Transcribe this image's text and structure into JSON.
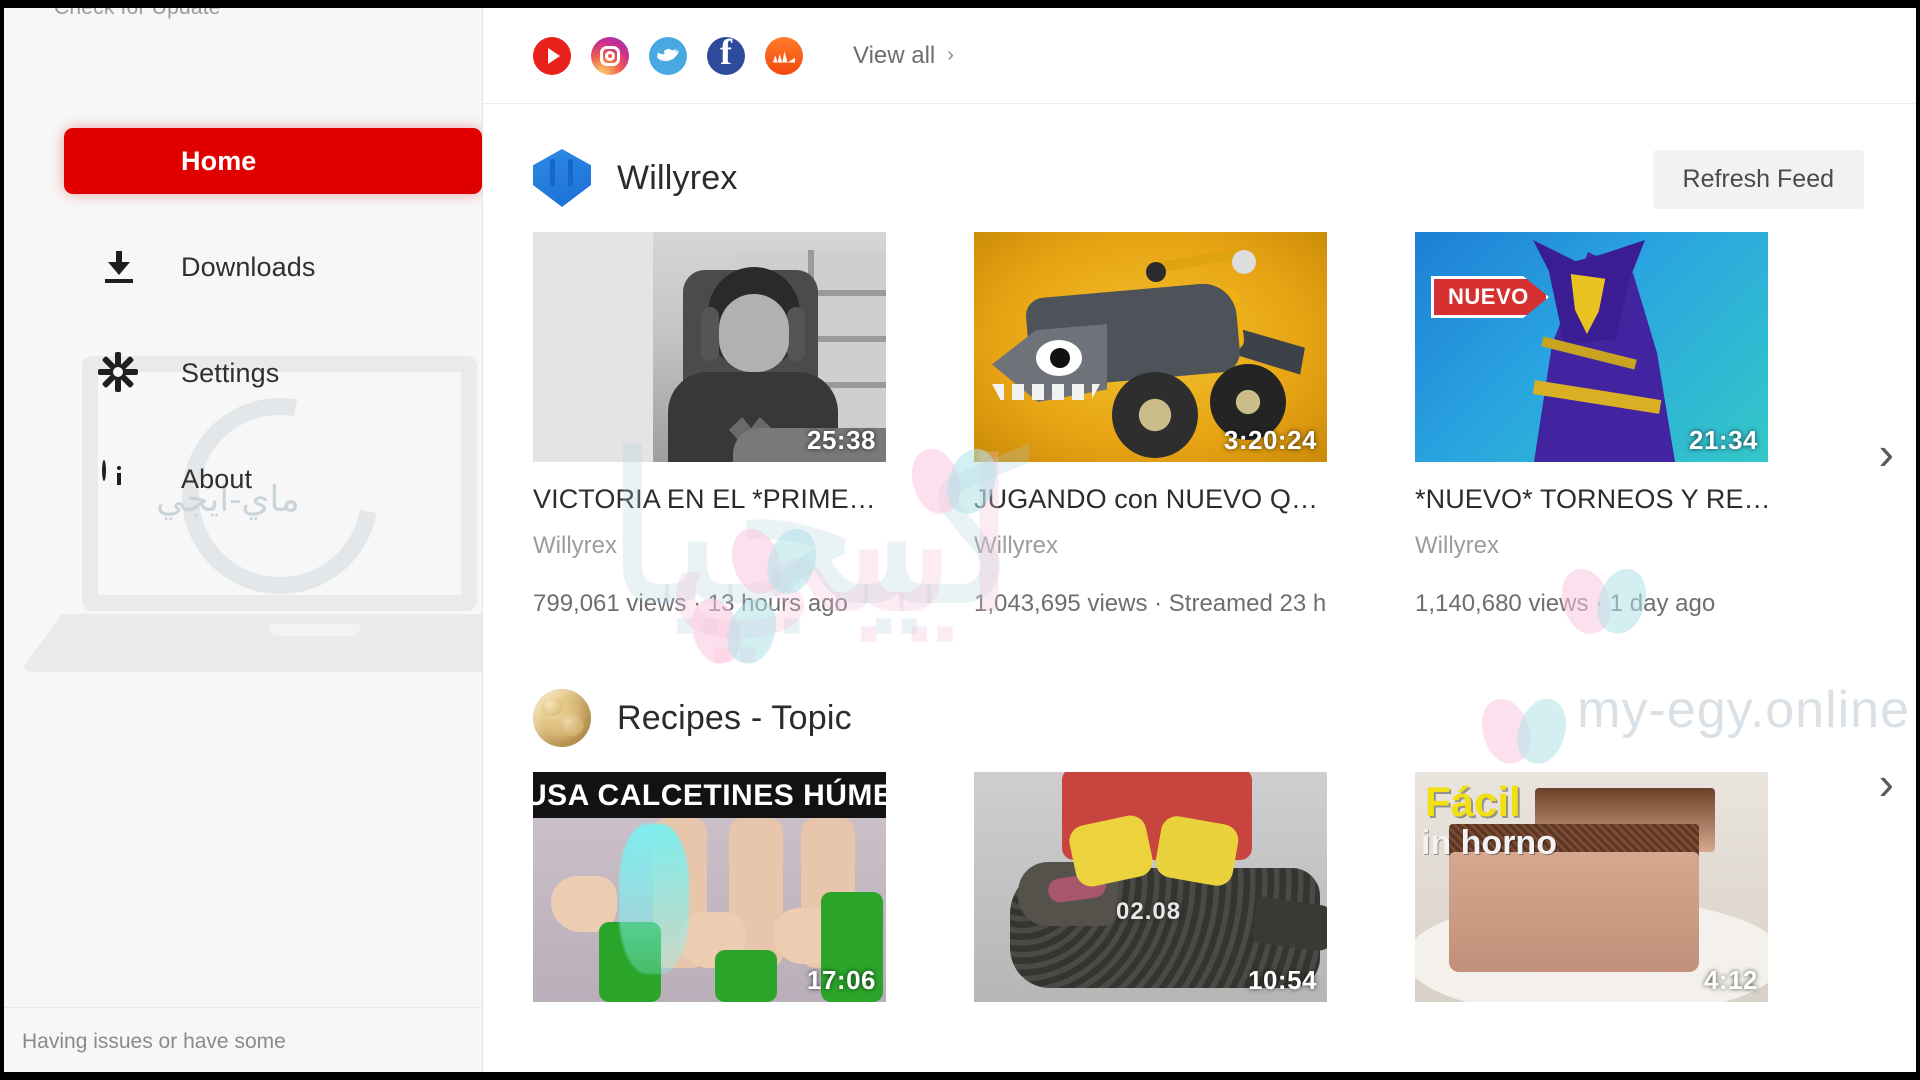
{
  "sidebar": {
    "update_label": "Check for Update",
    "items": [
      {
        "label": "Home",
        "icon": "compass-icon",
        "active": true
      },
      {
        "label": "Downloads",
        "icon": "download-icon",
        "active": false
      },
      {
        "label": "Settings",
        "icon": "gear-icon",
        "active": false
      },
      {
        "label": "About",
        "icon": "info-icon",
        "active": false
      }
    ],
    "watermark_arabic": "ماي-ايجي",
    "footer_text": "Having issues or have some"
  },
  "topbar": {
    "social_icons": [
      {
        "name": "youtube-icon",
        "color": "#e8211c"
      },
      {
        "name": "instagram-icon",
        "color": "#c92e8f"
      },
      {
        "name": "twitter-icon",
        "color": "#4aa8e0"
      },
      {
        "name": "facebook-icon",
        "color": "#2c4b9b"
      },
      {
        "name": "soundcloud-icon",
        "color": "#f04a0d"
      }
    ],
    "view_all_label": "View all",
    "view_all_chevron": "›"
  },
  "sections": [
    {
      "channel": "Willyrex",
      "avatar": "willyrex-avatar",
      "refresh_label": "Refresh Feed",
      "next_arrow": "›",
      "videos": [
        {
          "title": "VICTORIA EN EL *PRIME…",
          "channel": "Willyrex",
          "meta": "799,061 views · 13 hours ago",
          "duration": "25:38",
          "thumb": "gamer-grayscale-thumbnail"
        },
        {
          "title": "JUGANDO con NUEVO Q…",
          "channel": "Willyrex",
          "meta": "1,043,695 views · Streamed 23 h",
          "duration": "3:20:24",
          "thumb": "quad-bike-thumbnail"
        },
        {
          "title": "*NUEVO* TORNEOS Y RE…",
          "channel": "Willyrex",
          "meta": "1,140,680 views · 1 day ago",
          "duration": "21:34",
          "thumb": "fortnite-skin-thumbnail",
          "thumb_badge": "NUEVO"
        }
      ]
    },
    {
      "channel": "Recipes - Topic",
      "avatar": "recipes-avatar",
      "next_arrow": "›",
      "videos": [
        {
          "duration": "17:06",
          "thumb": "wet-socks-thumbnail",
          "thumb_headline": "USA CALCETINES HÚMEDOS"
        },
        {
          "duration": "10:54",
          "thumb": "alligator-thumbnail",
          "thumb_timecode": "02.08"
        },
        {
          "duration": "4:12",
          "thumb": "chocolate-cake-thumbnail",
          "thumb_headline": "Fácil",
          "thumb_subline": "in horno"
        }
      ]
    }
  ],
  "watermark": {
    "arabic_back": "كيجيا",
    "arabic_front": "ايبي",
    "domain": "my-egy.online"
  },
  "colors": {
    "accent_red": "#e00000",
    "sidebar_bg": "#f7f7f7",
    "main_bg": "#ffffff",
    "muted_text": "#9c9c9c"
  }
}
